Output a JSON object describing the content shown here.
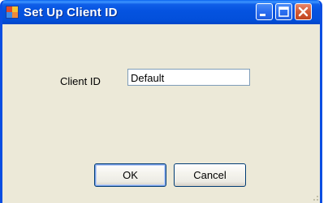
{
  "window": {
    "title": "Set Up Client ID",
    "icon": "application-icon",
    "controls": [
      "minimize-icon",
      "maximize-icon",
      "close-icon"
    ]
  },
  "form": {
    "client_id_label": "Client ID",
    "client_id_value": "Default"
  },
  "buttons": {
    "ok_label": "OK",
    "cancel_label": "Cancel"
  },
  "colors": {
    "titlebar": "#0553e0",
    "dialog_background": "#ece9d8",
    "close_button": "#d35a35",
    "input_border": "#7f9db9"
  }
}
